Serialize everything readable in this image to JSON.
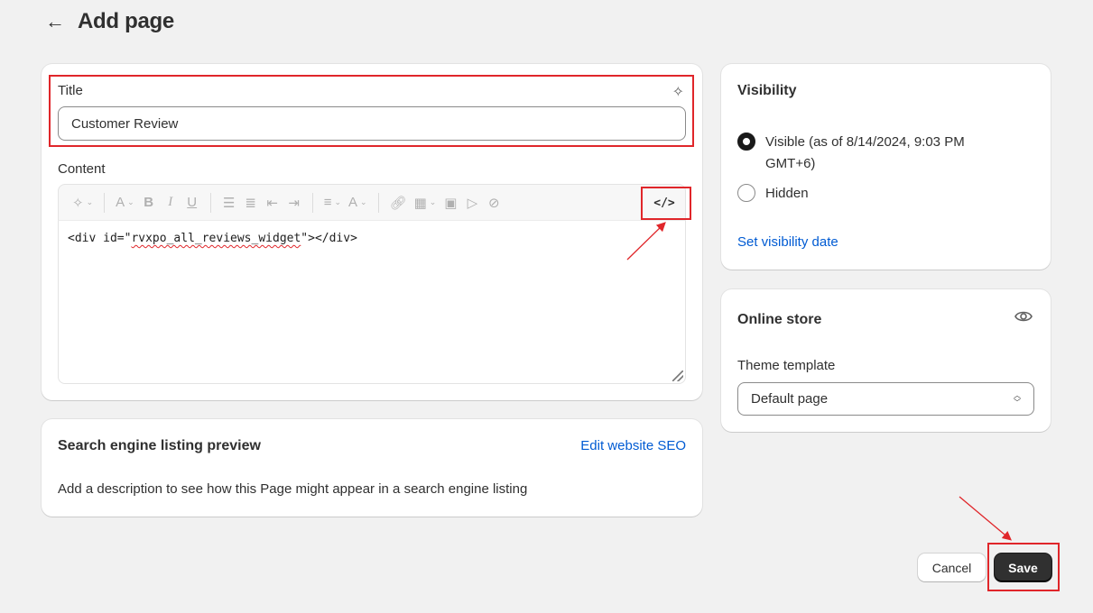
{
  "header": {
    "back_icon": "arrow-left-icon",
    "title": "Add page"
  },
  "main": {
    "title_label": "Title",
    "title_value": "Customer Review",
    "content_label": "Content",
    "editor_code_before": "<div id=\"",
    "editor_code_misspelled": "rvxpo_all_reviews_widget",
    "editor_code_after": "\"></div>",
    "toolbar_icons": [
      "sparkle-icon",
      "text-color-icon",
      "bold-icon",
      "italic-icon",
      "underline-icon",
      "bullet-list-icon",
      "numbered-list-icon",
      "outdent-icon",
      "indent-icon",
      "align-icon",
      "font-color-icon",
      "link-icon",
      "table-icon",
      "image-icon",
      "video-icon",
      "clear-format-icon",
      "code-icon"
    ],
    "code_button_glyph": "</>"
  },
  "seo": {
    "heading": "Search engine listing preview",
    "edit_link": "Edit website SEO",
    "description": "Add a description to see how this Page might appear in a search engine listing"
  },
  "visibility": {
    "heading": "Visibility",
    "options": [
      {
        "label": "Visible (as of 8/14/2024, 9:03 PM GMT+6)",
        "selected": true
      },
      {
        "label": "Hidden",
        "selected": false
      }
    ],
    "set_date_link": "Set visibility date"
  },
  "online_store": {
    "heading": "Online store",
    "template_label": "Theme template",
    "template_value": "Default page"
  },
  "actions": {
    "cancel": "Cancel",
    "save": "Save"
  },
  "colors": {
    "accent_link": "#005bd3",
    "annotation_red": "#e0262a",
    "primary_button": "#303030"
  }
}
